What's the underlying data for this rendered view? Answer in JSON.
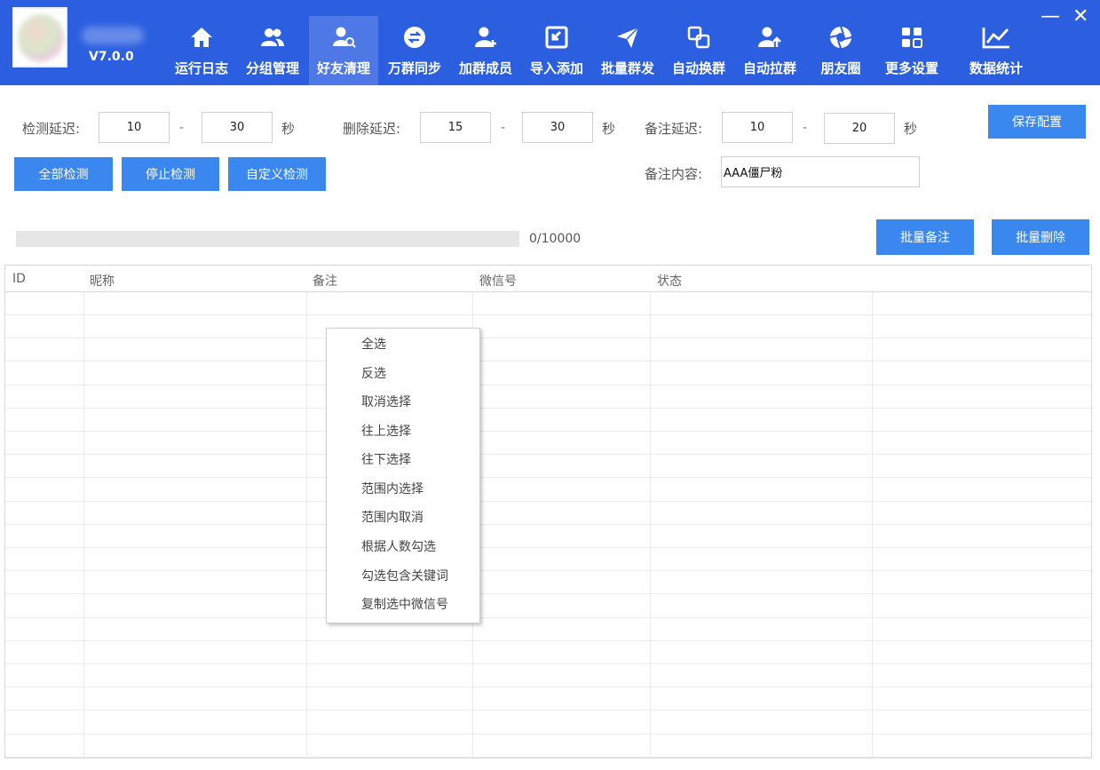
{
  "header": {
    "version": "V7.0.0",
    "nav": [
      {
        "label": "运行日志",
        "icon": "home-icon"
      },
      {
        "label": "分组管理",
        "icon": "users-icon"
      },
      {
        "label": "好友清理",
        "icon": "user-search-icon",
        "active": true
      },
      {
        "label": "万群同步",
        "icon": "sync-icon"
      },
      {
        "label": "加群成员",
        "icon": "user-add-icon"
      },
      {
        "label": "导入添加",
        "icon": "import-icon"
      },
      {
        "label": "批量群发",
        "icon": "send-icon"
      },
      {
        "label": "自动换群",
        "icon": "switch-icon"
      },
      {
        "label": "自动拉群",
        "icon": "user-up-icon"
      },
      {
        "label": "朋友圈",
        "icon": "aperture-icon"
      },
      {
        "label": "更多设置",
        "icon": "grid-icon"
      },
      {
        "label": "数据统计",
        "icon": "chart-icon"
      }
    ],
    "minimize": "—",
    "close": "✕"
  },
  "settings": {
    "check_delay_label": "检测延迟:",
    "check_delay_min": "10",
    "check_delay_max": "30",
    "delete_delay_label": "删除延迟:",
    "delete_delay_min": "15",
    "delete_delay_max": "30",
    "remark_delay_label": "备注延迟:",
    "remark_delay_min": "10",
    "remark_delay_max": "20",
    "unit": "秒",
    "dash": "-",
    "remark_content_label": "备注内容:",
    "remark_content_value": "AAA僵尸粉",
    "save_label": "保存配置"
  },
  "actions": {
    "check_all": "全部检测",
    "stop_check": "停止检测",
    "custom_check": "自定义检测",
    "batch_remark": "批量备注",
    "batch_delete": "批量删除"
  },
  "progress": {
    "text": "0/10000",
    "fraction": 0
  },
  "table": {
    "headers": [
      "ID",
      "昵称",
      "备注",
      "微信号",
      "状态"
    ],
    "rows": []
  },
  "context_menu": {
    "items": [
      "全选",
      "反选",
      "取消选择",
      "往上选择",
      "往下选择",
      "范围内选择",
      "范围内取消",
      "根据人数勾选",
      "勾选包含关键词",
      "复制选中微信号"
    ]
  },
  "colors": {
    "header_bg": "#2b5fe0",
    "active_tab": "#4d78e6",
    "button": "#3a87ef"
  }
}
